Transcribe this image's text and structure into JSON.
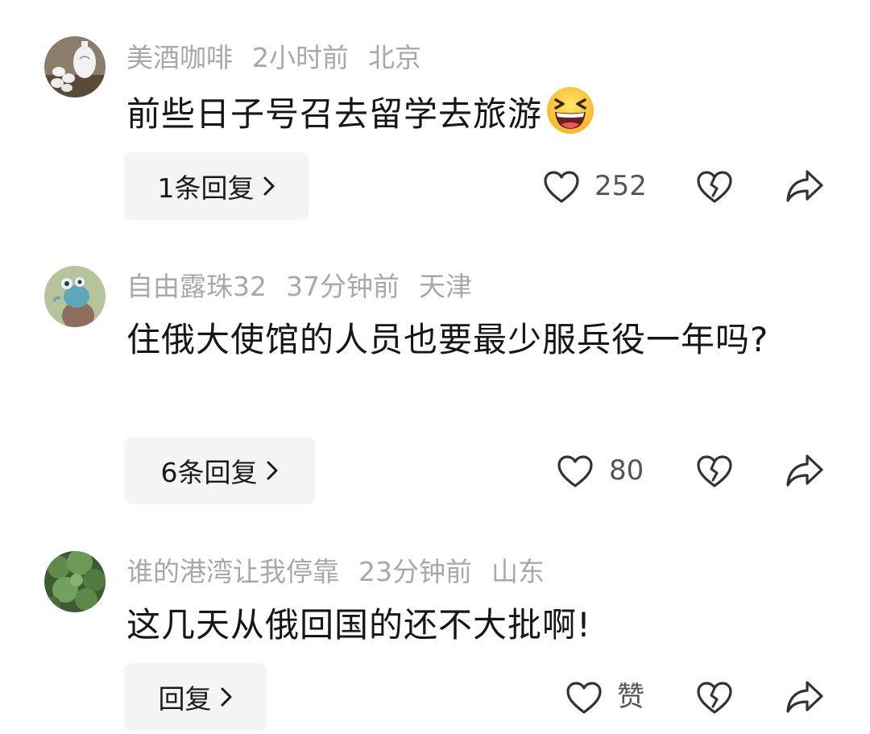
{
  "comments": [
    {
      "username": "美酒咖啡",
      "time": "2小时前",
      "location": "北京",
      "text": "前些日子号召去留学去旅游",
      "emoji": "grinning-squinting-face",
      "reply_label": "1条回复",
      "likes": "252"
    },
    {
      "username": "自由露珠32",
      "time": "37分钟前",
      "location": "天津",
      "text": "住俄大使馆的人员也要最少服兵役一年吗?",
      "reply_label": "6条回复",
      "likes": "80"
    },
    {
      "username": "谁的港湾让我停靠",
      "time": "23分钟前",
      "location": "山东",
      "text": "这几天从俄回国的还不大批啊!",
      "reply_label": "回复",
      "likes": "赞"
    }
  ],
  "icons": {
    "like": "heart-outline-icon",
    "dislike": "broken-heart-icon",
    "share": "share-arrow-icon",
    "chevron": "chevron-right-icon"
  }
}
